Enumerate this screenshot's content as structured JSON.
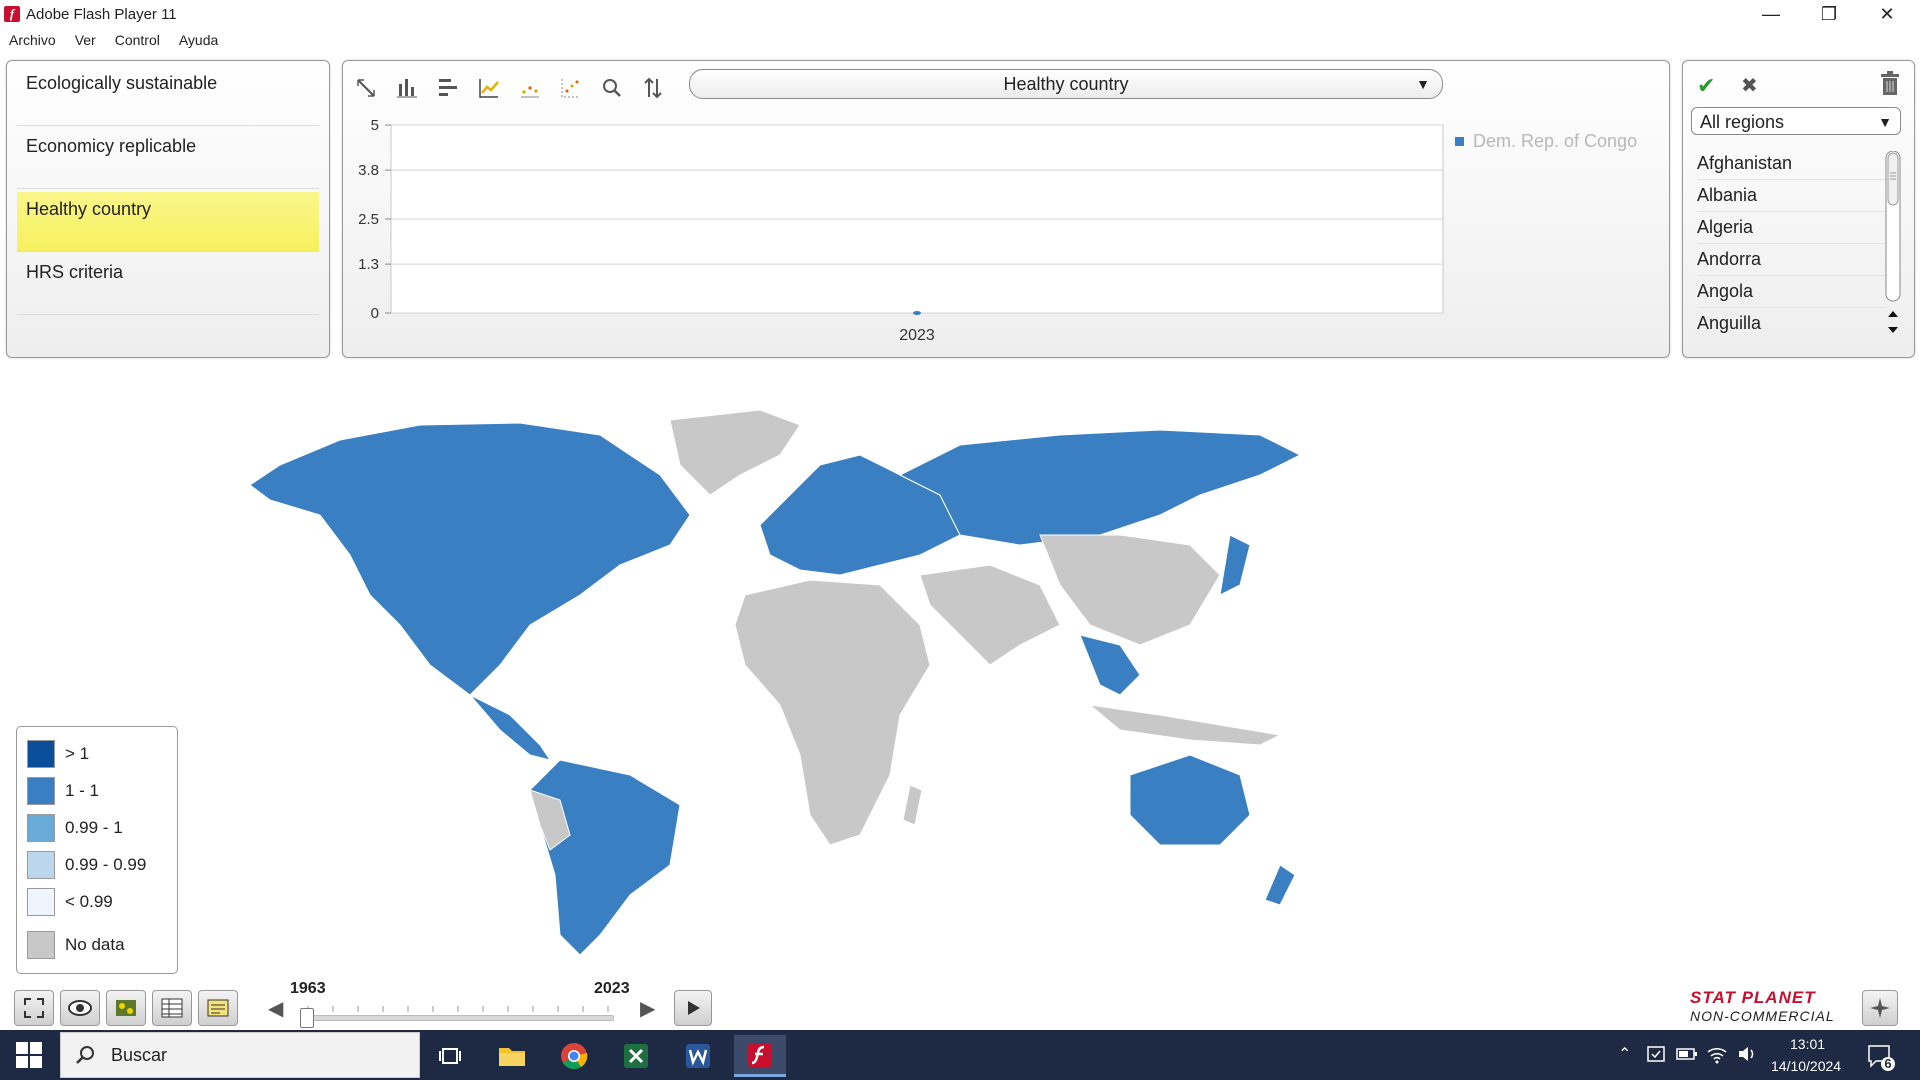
{
  "window": {
    "title": "Adobe Flash Player 11",
    "app_icon_glyph": "f"
  },
  "menu": [
    "Archivo",
    "Ver",
    "Control",
    "Ayuda"
  ],
  "indicators": [
    {
      "label": "Ecologically sustainable",
      "active": false
    },
    {
      "label": "Economicy replicable",
      "active": false
    },
    {
      "label": "Healthy country",
      "active": true
    },
    {
      "label": "HRS criteria",
      "active": false
    }
  ],
  "chart_toolbar": {
    "icons": [
      "line-diagonal-icon",
      "bar-chart-icon",
      "horizontal-bar-icon",
      "line-chart-icon",
      "dot-line-icon",
      "scatter-icon",
      "zoom-icon",
      "sort-icon"
    ],
    "selected_indicator": "Healthy country"
  },
  "chart_data": {
    "type": "scatter",
    "x": [
      "2023"
    ],
    "series": [
      {
        "name": "Dem. Rep. of Congo",
        "values": [
          0
        ],
        "color": "#3a7fc1"
      }
    ],
    "yticks": [
      "5",
      "3.8",
      "2.5",
      "1.3",
      "0"
    ],
    "ylim": [
      0,
      5
    ],
    "grid": true,
    "legend_placement": "right"
  },
  "region_panel": {
    "region_select": "All regions",
    "countries": [
      "Afghanistan",
      "Albania",
      "Algeria",
      "Andorra",
      "Angola",
      "Anguilla"
    ]
  },
  "legend": {
    "items": [
      {
        "label": "> 1",
        "color": "#0b4e9a"
      },
      {
        "label": "1 - 1",
        "color": "#3a7fc1"
      },
      {
        "label": "0.99 - 1",
        "color": "#6aaad8"
      },
      {
        "label": "0.99 - 0.99",
        "color": "#bcd6ee"
      },
      {
        "label": "< 0.99",
        "color": "#eef5fd"
      },
      {
        "label": "No data",
        "color": "#c8c8c8"
      }
    ]
  },
  "timeline": {
    "start_year": "1963",
    "end_year": "2023",
    "position": 0.0
  },
  "brand": {
    "line1": "STAT PLANET",
    "line2": "NON-COMMERCIAL"
  },
  "taskbar": {
    "search_placeholder": "Buscar",
    "apps": [
      "task-view-icon",
      "file-explorer-icon",
      "chrome-icon",
      "excel-icon",
      "word-icon",
      "flash-player-icon"
    ],
    "time": "13:01",
    "date": "14/10/2024",
    "notification_count": "6"
  },
  "colors": {
    "land_data": "#3a7fc1",
    "land_nodata": "#c8c8c8",
    "accent_yellow": "#f6f15e"
  }
}
